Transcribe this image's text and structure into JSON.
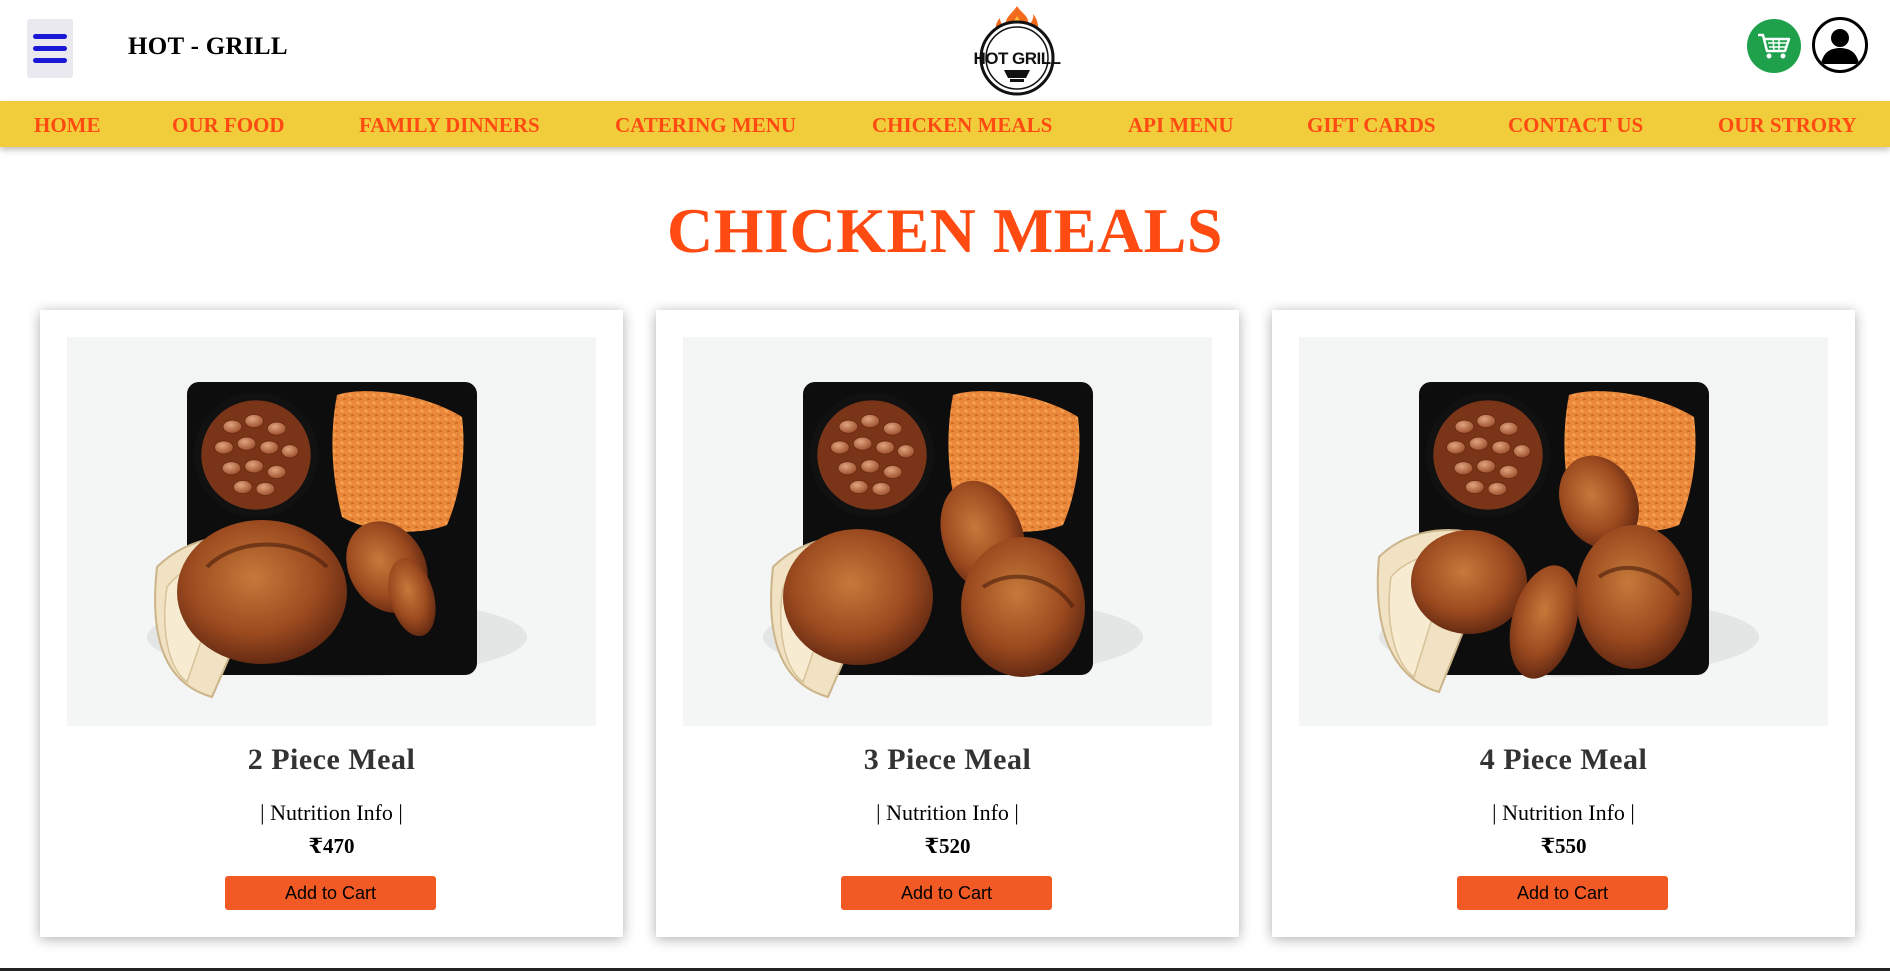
{
  "header": {
    "brand": "HOT - GRILL",
    "logo_text": "HOT GRILL"
  },
  "nav": {
    "items": [
      {
        "label": "HOME"
      },
      {
        "label": "OUR FOOD"
      },
      {
        "label": "FAMILY DINNERS"
      },
      {
        "label": "CATERING MENU"
      },
      {
        "label": "CHICKEN MEALS"
      },
      {
        "label": "API MENU"
      },
      {
        "label": "GIFT CARDS"
      },
      {
        "label": "CONTACT US"
      },
      {
        "label": "OUR STRORY"
      }
    ]
  },
  "main": {
    "title": "CHICKEN MEALS",
    "cards": [
      {
        "name": "2 Piece Meal",
        "nutrition": "Nutrition Info",
        "price": "₹470",
        "button": "Add to Cart"
      },
      {
        "name": "3 Piece Meal",
        "nutrition": "Nutrition Info",
        "price": "₹520",
        "button": "Add to Cart"
      },
      {
        "name": "4 Piece Meal",
        "nutrition": "Nutrition Info",
        "price": "₹550",
        "button": "Add to Cart"
      }
    ]
  },
  "icons": {
    "menu": "hamburger-menu-icon",
    "cart": "shopping-cart-icon",
    "user": "user-account-icon",
    "logo": "flame-grill-logo"
  },
  "colors": {
    "accent": "#ff4b12",
    "nav_background": "#f1cd3c",
    "button": "#f15a24",
    "cart": "#1ea14a",
    "menu_bars": "#1b17d6"
  }
}
